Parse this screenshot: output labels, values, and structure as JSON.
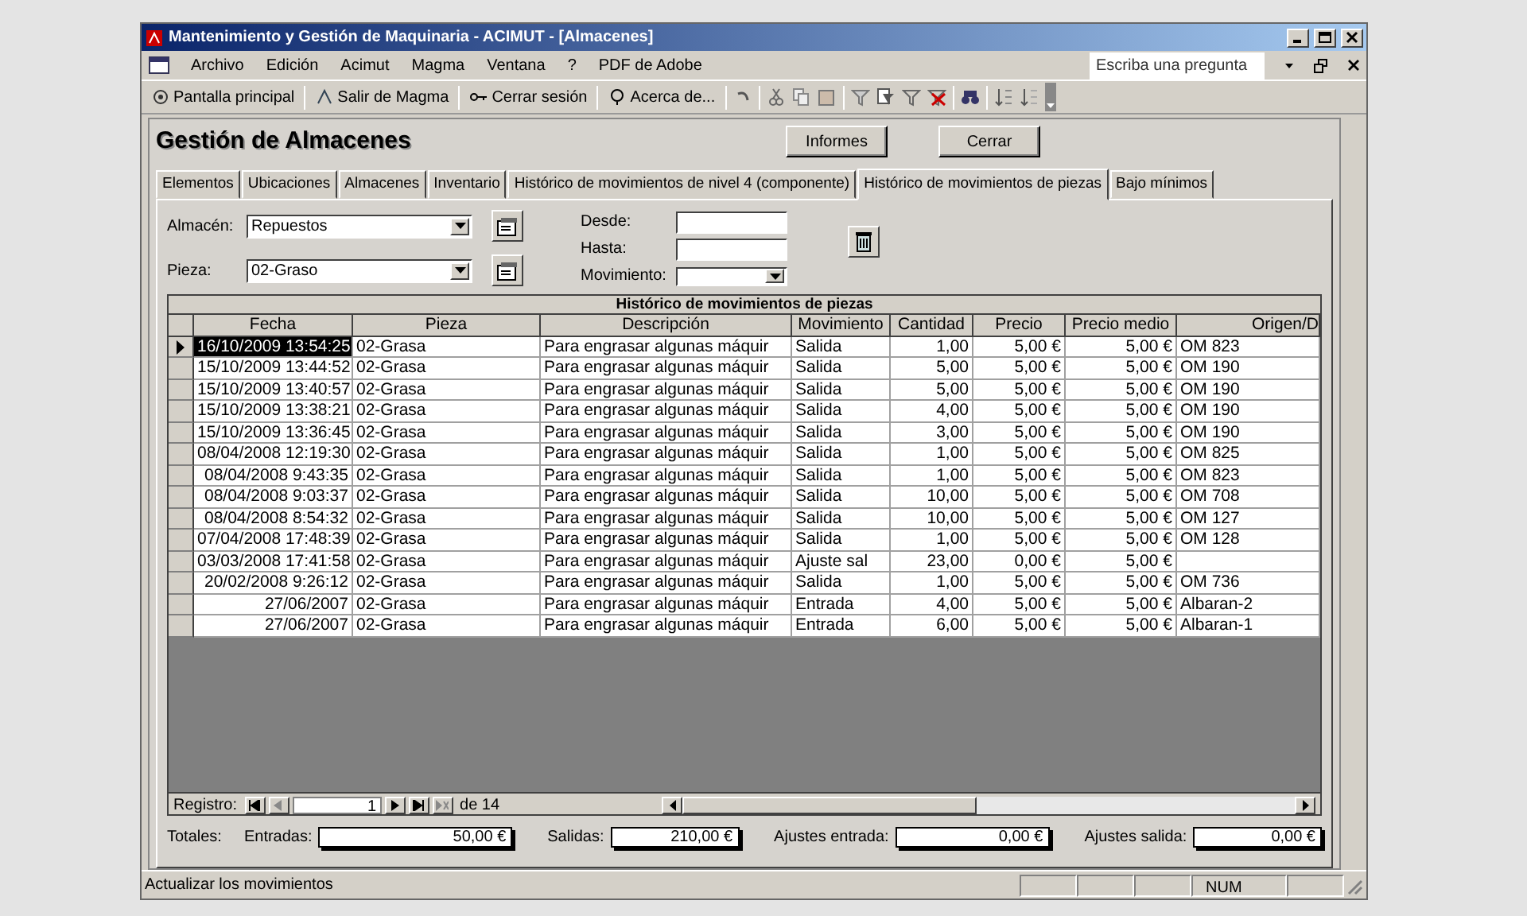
{
  "window": {
    "title": "Mantenimiento y Gestión de Maquinaria - ACIMUT - [Almacenes]"
  },
  "menu": {
    "items": [
      "Archivo",
      "Edición",
      "Acimut",
      "Magma",
      "Ventana",
      "?",
      "PDF de Adobe"
    ],
    "help_box": "Escriba una pregunta"
  },
  "toolbar": {
    "items": [
      "Pantalla principal",
      "Salir de Magma",
      "Cerrar sesión",
      "Acerca de..."
    ]
  },
  "form": {
    "title": "Gestión de Almacenes",
    "buttons": [
      "Informes",
      "Cerrar"
    ]
  },
  "tabs": [
    {
      "label": "Elementos",
      "selected": false
    },
    {
      "label": "Ubicaciones",
      "selected": false
    },
    {
      "label": "Almacenes",
      "selected": false
    },
    {
      "label": "Inventario",
      "selected": false
    },
    {
      "label": "Histórico de movimientos de nivel 4 (componente)",
      "selected": false
    },
    {
      "label": "Histórico de movimientos de piezas",
      "selected": true
    },
    {
      "label": "Bajo mínimos",
      "selected": false
    }
  ],
  "filters": {
    "almacen": {
      "label": "Almacén:",
      "value": "Repuestos"
    },
    "pieza": {
      "label": "Pieza:",
      "value": "02-Graso"
    },
    "desde": {
      "label": "Desde:"
    },
    "hasta": {
      "label": "Hasta:"
    },
    "movimiento": {
      "label": "Movimiento:"
    }
  },
  "grid": {
    "title": "Histórico de movimientos de piezas",
    "columns": [
      "Fecha",
      "Pieza",
      "Descripción",
      "Movimiento",
      "Cantidad",
      "Precio",
      "Precio medio",
      "Origen/D"
    ],
    "rows": [
      {
        "selected": true,
        "cells": [
          "16/10/2009 13:54:25",
          "02-Grasa",
          "Para engrasar algunas máquir",
          "Salida",
          "1,00",
          "5,00 €",
          "5,00 €",
          "OM 823"
        ]
      },
      {
        "selected": false,
        "cells": [
          "15/10/2009 13:44:52",
          "02-Grasa",
          "Para engrasar algunas máquir",
          "Salida",
          "5,00",
          "5,00 €",
          "5,00 €",
          "OM 190"
        ]
      },
      {
        "selected": false,
        "cells": [
          "15/10/2009 13:40:57",
          "02-Grasa",
          "Para engrasar algunas máquir",
          "Salida",
          "5,00",
          "5,00 €",
          "5,00 €",
          "OM 190"
        ]
      },
      {
        "selected": false,
        "cells": [
          "15/10/2009 13:38:21",
          "02-Grasa",
          "Para engrasar algunas máquir",
          "Salida",
          "4,00",
          "5,00 €",
          "5,00 €",
          "OM 190"
        ]
      },
      {
        "selected": false,
        "cells": [
          "15/10/2009 13:36:45",
          "02-Grasa",
          "Para engrasar algunas máquir",
          "Salida",
          "3,00",
          "5,00 €",
          "5,00 €",
          "OM 190"
        ]
      },
      {
        "selected": false,
        "cells": [
          "08/04/2008 12:19:30",
          "02-Grasa",
          "Para engrasar algunas máquir",
          "Salida",
          "1,00",
          "5,00 €",
          "5,00 €",
          "OM 825"
        ]
      },
      {
        "selected": false,
        "cells": [
          "08/04/2008 9:43:35",
          "02-Grasa",
          "Para engrasar algunas máquir",
          "Salida",
          "1,00",
          "5,00 €",
          "5,00 €",
          "OM 823"
        ]
      },
      {
        "selected": false,
        "cells": [
          "08/04/2008 9:03:37",
          "02-Grasa",
          "Para engrasar algunas máquir",
          "Salida",
          "10,00",
          "5,00 €",
          "5,00 €",
          "OM 708"
        ]
      },
      {
        "selected": false,
        "cells": [
          "08/04/2008 8:54:32",
          "02-Grasa",
          "Para engrasar algunas máquir",
          "Salida",
          "10,00",
          "5,00 €",
          "5,00 €",
          "OM 127"
        ]
      },
      {
        "selected": false,
        "cells": [
          "07/04/2008 17:48:39",
          "02-Grasa",
          "Para engrasar algunas máquir",
          "Salida",
          "1,00",
          "5,00 €",
          "5,00 €",
          "OM 128"
        ]
      },
      {
        "selected": false,
        "cells": [
          "03/03/2008 17:41:58",
          "02-Grasa",
          "Para engrasar algunas máquir",
          "Ajuste sal",
          "23,00",
          "0,00 €",
          "5,00 €",
          ""
        ]
      },
      {
        "selected": false,
        "cells": [
          "20/02/2008 9:26:12",
          "02-Grasa",
          "Para engrasar algunas máquir",
          "Salida",
          "1,00",
          "5,00 €",
          "5,00 €",
          "OM 736"
        ]
      },
      {
        "selected": false,
        "cells": [
          "27/06/2007",
          "02-Grasa",
          "Para engrasar algunas máquir",
          "Entrada",
          "4,00",
          "5,00 €",
          "5,00 €",
          "Albaran-2"
        ]
      },
      {
        "selected": false,
        "cells": [
          "27/06/2007",
          "02-Grasa",
          "Para engrasar algunas máquir",
          "Entrada",
          "6,00",
          "5,00 €",
          "5,00 €",
          "Albaran-1"
        ]
      }
    ],
    "navigation": {
      "label": "Registro:",
      "value": "1",
      "of": "de 14"
    }
  },
  "totals": {
    "label": "Totales:",
    "fields": [
      {
        "label": "Entradas:",
        "value": "50,00 €"
      },
      {
        "label": "Salidas:",
        "value": "210,00 €"
      },
      {
        "label": "Ajustes entrada:",
        "value": "0,00 €"
      },
      {
        "label": "Ajustes salida:",
        "value": "0,00 €"
      }
    ]
  },
  "status_bar": {
    "text": "Actualizar los movimientos",
    "indicator": "NUM"
  }
}
